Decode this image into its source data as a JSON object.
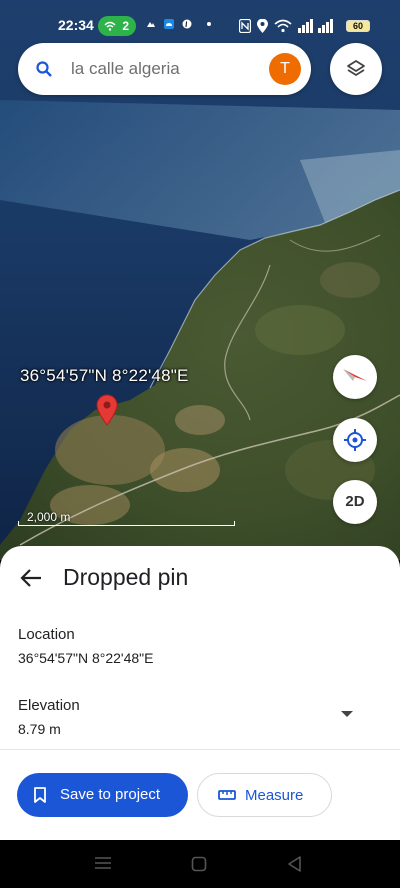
{
  "status_bar": {
    "time": "22:34",
    "notification_count": "2",
    "battery": "60"
  },
  "search": {
    "query": "la calle algeria",
    "avatar_letter": "T"
  },
  "map": {
    "coordinates_label": "36°54'57\"N 8°22'48\"E",
    "scale_label": "2,000 m",
    "view_mode_label": "2D"
  },
  "sheet": {
    "title": "Dropped pin",
    "location_label": "Location",
    "location_value": "36°54'57\"N 8°22'48\"E",
    "elevation_label": "Elevation",
    "elevation_value": "8.79 m",
    "save_button": "Save to project",
    "measure_button": "Measure"
  },
  "colors": {
    "accent": "#1a56d6",
    "avatar": "#ef6c00",
    "pin": "#e53935",
    "status_pill": "#2db34a"
  },
  "icons": {
    "search": "search-icon",
    "layers": "layers-icon",
    "compass": "compass-icon",
    "location": "my-location-icon",
    "back": "back-arrow-icon",
    "bookmark": "bookmark-icon",
    "ruler": "ruler-icon",
    "dropdown": "chevron-down-icon"
  }
}
